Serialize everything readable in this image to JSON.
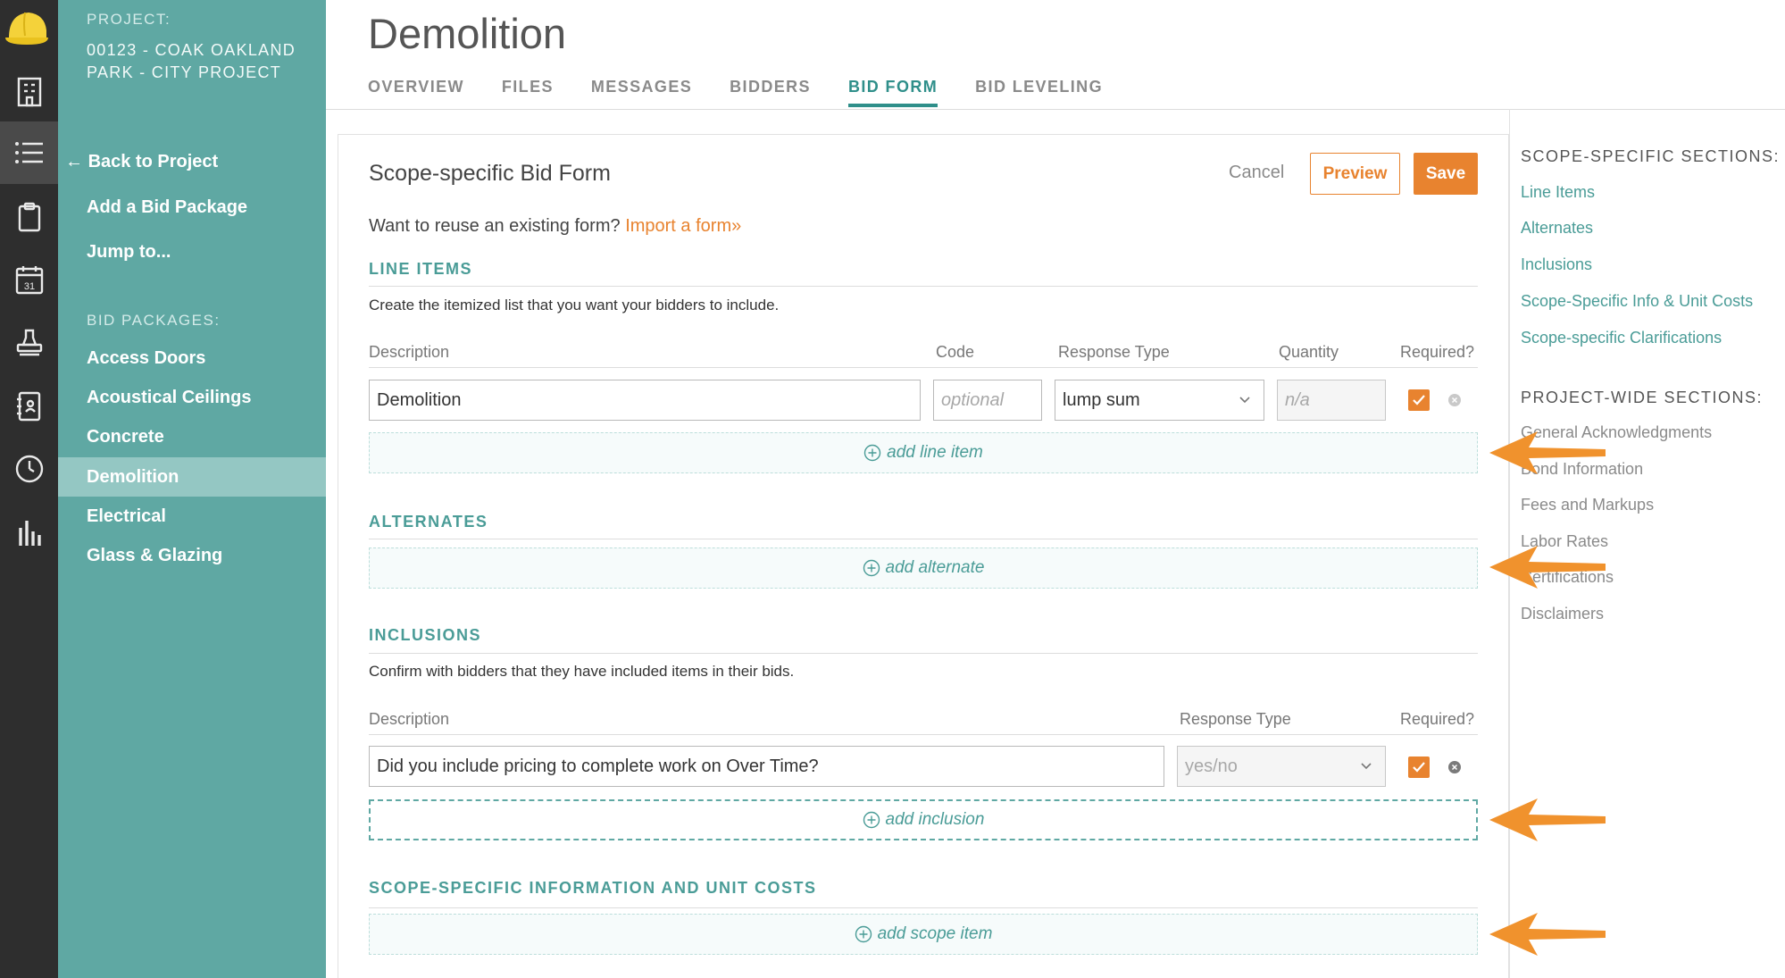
{
  "sidebar": {
    "project_label": "PROJECT:",
    "project_name": "00123 - COAK OAKLAND PARK - CITY PROJECT",
    "back_arrow": "←",
    "back": "Back to Project",
    "add_package": "Add a Bid Package",
    "jump": "Jump to...",
    "packages_label": "BID PACKAGES:",
    "packages": [
      "Access Doors",
      "Acoustical Ceilings",
      "Concrete",
      "Demolition",
      "Electrical",
      "Glass & Glazing"
    ]
  },
  "header": {
    "title": "Demolition",
    "tabs": [
      "OVERVIEW",
      "FILES",
      "MESSAGES",
      "BIDDERS",
      "BID FORM",
      "BID LEVELING"
    ],
    "active_tab": "BID FORM"
  },
  "form": {
    "title": "Scope-specific Bid Form",
    "cancel": "Cancel",
    "preview": "Preview",
    "save": "Save",
    "reuse_text": "Want to reuse an existing form?",
    "import_link": "Import a form»"
  },
  "line_items": {
    "heading": "LINE ITEMS",
    "description": "Create the itemized list that you want your bidders to include.",
    "columns": [
      "Description",
      "Code",
      "Response Type",
      "Quantity",
      "Required?"
    ],
    "row": {
      "description": "Demolition",
      "code_placeholder": "optional",
      "response_type": "lump sum",
      "quantity_placeholder": "n/a",
      "required": true
    },
    "add_label": "add line item"
  },
  "alternates": {
    "heading": "ALTERNATES",
    "add_label": "add alternate"
  },
  "inclusions": {
    "heading": "INCLUSIONS",
    "description": "Confirm with bidders that they have included items in their bids.",
    "columns": [
      "Description",
      "Response Type",
      "Required?"
    ],
    "row": {
      "description": "Did you include pricing to complete work on Over Time?",
      "response_type": "yes/no",
      "required": true
    },
    "add_label": "add inclusion"
  },
  "scope_info": {
    "heading": "SCOPE-SPECIFIC INFORMATION AND UNIT COSTS",
    "add_label": "add scope item"
  },
  "right_rail": {
    "scope_heading": "SCOPE-SPECIFIC SECTIONS:",
    "scope_links": [
      "Line Items",
      "Alternates",
      "Inclusions",
      "Scope-Specific Info & Unit Costs",
      "Scope-specific Clarifications"
    ],
    "project_heading": "PROJECT-WIDE SECTIONS:",
    "project_links": [
      "General Acknowledgments",
      "Bond Information",
      "Fees and Markups",
      "Labor Rates",
      "Certifications",
      "Disclaimers"
    ]
  },
  "colors": {
    "teal": "#5fa8a3",
    "teal_dark": "#4a9c97",
    "orange": "#e8832f",
    "rail": "#2e2e2e"
  },
  "icons": [
    "hardhat-logo-icon",
    "building-icon",
    "list-icon",
    "clipboard-icon",
    "calendar-icon",
    "stamp-icon",
    "contacts-book-icon",
    "clock-icon",
    "bar-chart-icon",
    "plus-circle-icon",
    "chevron-down-icon",
    "check-icon",
    "close-icon",
    "arrow-left-icon"
  ],
  "calendar_day": "31"
}
